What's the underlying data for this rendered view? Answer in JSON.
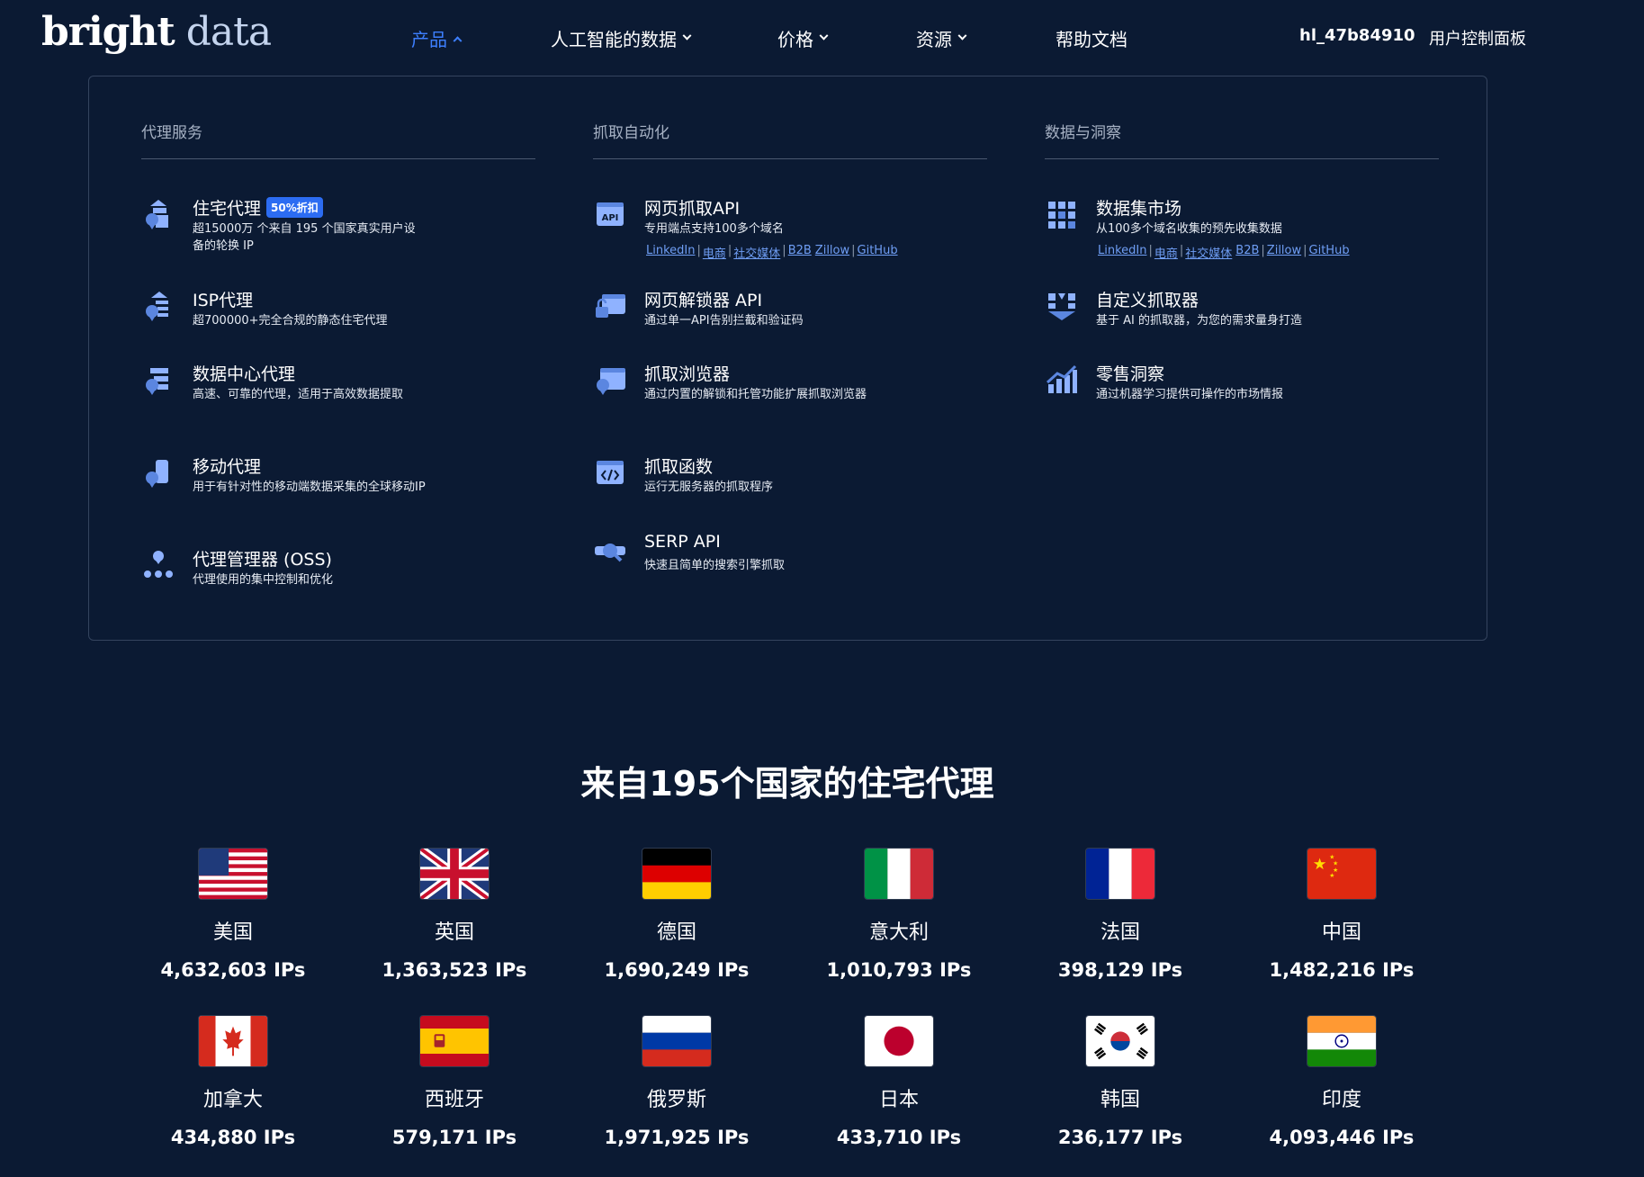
{
  "brand": {
    "logo_bold": "bright",
    "logo_light": " data"
  },
  "nav": {
    "products": "产品",
    "ai_data": "人工智能的数据",
    "pricing": "价格",
    "resources": "资源",
    "docs": "帮助文档",
    "user": "hl_47b84910",
    "dashboard": "用户控制面板"
  },
  "menu": {
    "col1": {
      "heading": "代理服务",
      "items": [
        {
          "title": "住宅代理",
          "badge": "50%折扣",
          "desc": "超15000万 个来自 195 个国家真实用户设备的轮换 IP",
          "icon": "residential-proxy-icon"
        },
        {
          "title": "ISP代理",
          "desc": "超700000+完全合规的静态住宅代理",
          "icon": "isp-proxy-icon"
        },
        {
          "title": "数据中心代理",
          "desc": "高速、可靠的代理，适用于高效数据提取",
          "icon": "datacenter-proxy-icon"
        },
        {
          "title": "移动代理",
          "desc": "用于有针对性的移动端数据采集的全球移动IP",
          "icon": "mobile-proxy-icon"
        },
        {
          "title": "代理管理器 (OSS)",
          "desc": "代理使用的集中控制和优化",
          "icon": "proxy-manager-icon"
        }
      ]
    },
    "col2": {
      "heading": "抓取自动化",
      "items": [
        {
          "title": "网页抓取API",
          "desc": "专用端点支持100多个域名",
          "icon": "api-icon",
          "links": [
            "LinkedIn",
            "电商",
            "社交媒体",
            "B2B",
            "Zillow",
            "GitHub"
          ]
        },
        {
          "title": "网页解锁器 API",
          "desc": "通过单一API告别拦截和验证码",
          "icon": "unlocker-icon"
        },
        {
          "title": "抓取浏览器",
          "desc": "通过内置的解锁和托管功能扩展抓取浏览器",
          "icon": "browser-icon"
        },
        {
          "title": "抓取函数",
          "desc": "运行无服务器的抓取程序",
          "icon": "code-icon"
        },
        {
          "title": "SERP API",
          "desc": "快速且简单的搜索引擎抓取",
          "icon": "serp-icon"
        }
      ]
    },
    "col3": {
      "heading": "数据与洞察",
      "items": [
        {
          "title": "数据集市场",
          "desc": "从100多个域名收集的预先收集数据",
          "icon": "grid-icon",
          "links": [
            "LinkedIn",
            "电商",
            "社交媒体",
            "B2B",
            "Zillow",
            "GitHub"
          ]
        },
        {
          "title": "自定义抓取器",
          "desc": "基于 AI 的抓取器，为您的需求量身打造",
          "icon": "custom-scraper-icon"
        },
        {
          "title": "零售洞察",
          "desc": "通过机器学习提供可操作的市场情报",
          "icon": "chart-icon"
        }
      ]
    }
  },
  "countries_section": {
    "title": "来自195个国家的住宅代理",
    "countries": [
      {
        "name": "美国",
        "ips": "4,632,603 IPs",
        "flag": "us-flag-icon"
      },
      {
        "name": "英国",
        "ips": "1,363,523 IPs",
        "flag": "uk-flag-icon"
      },
      {
        "name": "德国",
        "ips": "1,690,249 IPs",
        "flag": "germany-flag-icon"
      },
      {
        "name": "意大利",
        "ips": "1,010,793 IPs",
        "flag": "italy-flag-icon"
      },
      {
        "name": "法国",
        "ips": "398,129 IPs",
        "flag": "france-flag-icon"
      },
      {
        "name": "中国",
        "ips": "1,482,216 IPs",
        "flag": "china-flag-icon"
      },
      {
        "name": "加拿大",
        "ips": "434,880 IPs",
        "flag": "canada-flag-icon"
      },
      {
        "name": "西班牙",
        "ips": "579,171 IPs",
        "flag": "spain-flag-icon"
      },
      {
        "name": "俄罗斯",
        "ips": "1,971,925 IPs",
        "flag": "russia-flag-icon"
      },
      {
        "name": "日本",
        "ips": "433,710 IPs",
        "flag": "japan-flag-icon"
      },
      {
        "name": "韩国",
        "ips": "236,177 IPs",
        "flag": "korea-flag-icon"
      },
      {
        "name": "印度",
        "ips": "4,093,446 IPs",
        "flag": "india-flag-icon"
      }
    ]
  },
  "colors": {
    "background": "#0b1a33",
    "accent": "#3d7fff",
    "icon": "#8fb2ff",
    "link": "#6f9ef5",
    "badge": "#2c6cf2"
  }
}
